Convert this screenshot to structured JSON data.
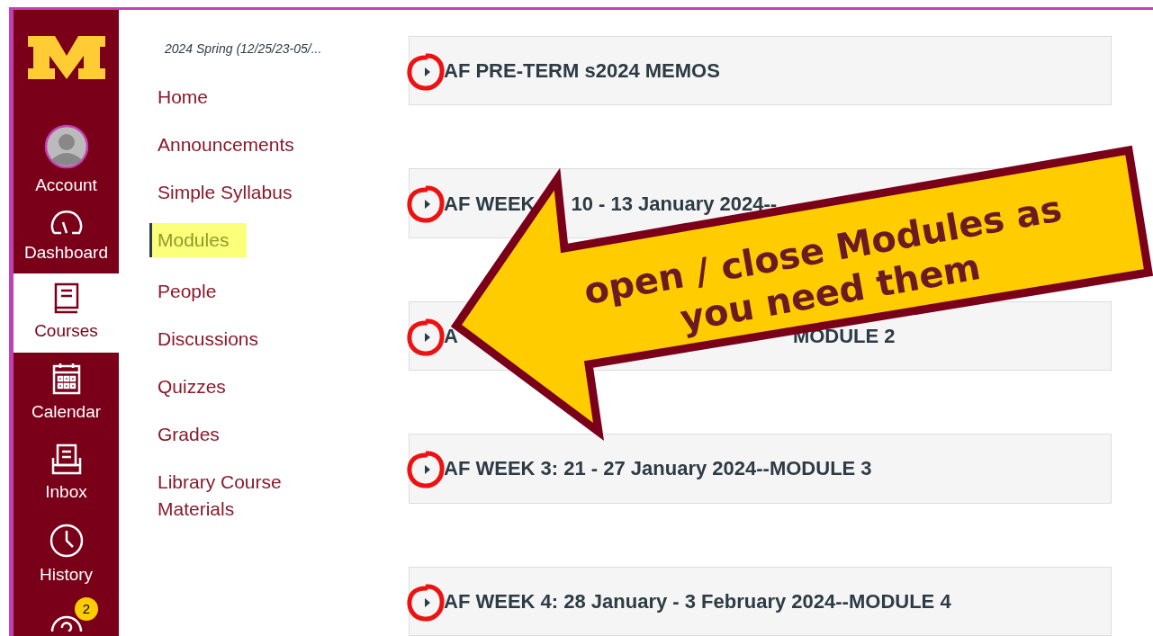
{
  "global_nav": {
    "items": [
      {
        "kind": "account",
        "label": "Account",
        "selected": false
      },
      {
        "kind": "dashboard",
        "label": "Dashboard",
        "selected": false
      },
      {
        "kind": "courses",
        "label": "Courses",
        "selected": true
      },
      {
        "kind": "calendar",
        "label": "Calendar",
        "selected": false
      },
      {
        "kind": "inbox",
        "label": "Inbox",
        "selected": false
      },
      {
        "kind": "history",
        "label": "History",
        "selected": false
      },
      {
        "kind": "help",
        "badge": "2",
        "selected": false
      }
    ]
  },
  "course_nav": {
    "term": "2024 Spring (12/25/23-05/...",
    "items": [
      {
        "label": "Home",
        "selected": false
      },
      {
        "label": "Announcements",
        "selected": false
      },
      {
        "label": "Simple Syllabus",
        "selected": false
      },
      {
        "label": "Modules",
        "selected": true
      },
      {
        "label": "People",
        "selected": false
      },
      {
        "label": "Discussions",
        "selected": false
      },
      {
        "label": "Quizzes",
        "selected": false
      },
      {
        "label": "Grades",
        "selected": false
      },
      {
        "label": "Library Course Materials",
        "selected": false
      }
    ]
  },
  "modules": [
    {
      "expanded": false,
      "title_parts": [
        "AF PRE-TERM s2024 MEMOS"
      ]
    },
    {
      "expanded": false,
      "title_parts": [
        "AF WEEK",
        "10 - 13 January 2024--"
      ]
    },
    {
      "expanded": false,
      "title_parts": [
        "A",
        "MODULE 2"
      ]
    },
    {
      "expanded": false,
      "title_parts": [
        "AF WEEK 3: 21 - 27 January 2024--MODULE 3"
      ]
    },
    {
      "expanded": false,
      "title_parts": [
        "AF WEEK 4: 28 January - 3 February 2024--MODULE 4"
      ]
    }
  ],
  "callout": {
    "lines": [
      "open / close Modules as",
      "you need them"
    ]
  }
}
